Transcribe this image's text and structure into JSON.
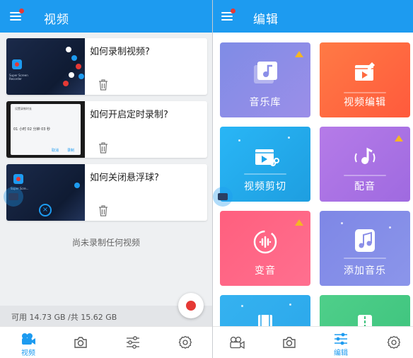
{
  "left": {
    "header": {
      "title": "视频"
    },
    "cards": [
      {
        "title": "如何录制视频?",
        "thumb_caption": "Super Screen Recorder"
      },
      {
        "title": "如何开启定时录制?",
        "thumb_caption": "设置录制时长",
        "thumb_row": "01 小时   02 分钟   03 秒",
        "thumb_cancel": "取消",
        "thumb_ok": "录制"
      },
      {
        "title": "如何关闭悬浮球?",
        "thumb_caption": "Super Scre..."
      }
    ],
    "empty_text": "尚未录制任何视频",
    "storage_text": "可用 14.73 GB /共 15.62 GB",
    "nav": {
      "active_label": "视频"
    }
  },
  "right": {
    "header": {
      "title": "编辑"
    },
    "tiles": [
      {
        "label": "音乐库",
        "icon": "music-library-icon",
        "color_from": "#7f8ce6",
        "color_to": "#9b8ee8"
      },
      {
        "label": "视频编辑",
        "icon": "video-edit-icon",
        "color_from": "#ff7a45",
        "color_to": "#ff5a3c"
      },
      {
        "label": "视频剪切",
        "icon": "video-cut-icon",
        "color_from": "#29b6f6",
        "color_to": "#1e9ee0"
      },
      {
        "label": "配音",
        "icon": "dubbing-icon",
        "color_from": "#b57be8",
        "color_to": "#9f6ae0"
      },
      {
        "label": "变音",
        "icon": "voice-change-icon",
        "color_from": "#ff5f7e",
        "color_to": "#ff6f8f"
      },
      {
        "label": "添加音乐",
        "icon": "add-music-icon",
        "color_from": "#7e87e6",
        "color_to": "#8b95ea"
      },
      {
        "label": "",
        "icon": "film-strip-icon",
        "color_from": "#35b2f0",
        "color_to": "#2aa6ea"
      },
      {
        "label": "",
        "icon": "compress-icon",
        "color_from": "#4fcf8a",
        "color_to": "#3cc27c"
      }
    ],
    "nav": {
      "active_label": "编辑"
    }
  },
  "colors": {
    "primary": "#1d9bf0",
    "record": "#e53935",
    "crown": "#f5b623"
  }
}
